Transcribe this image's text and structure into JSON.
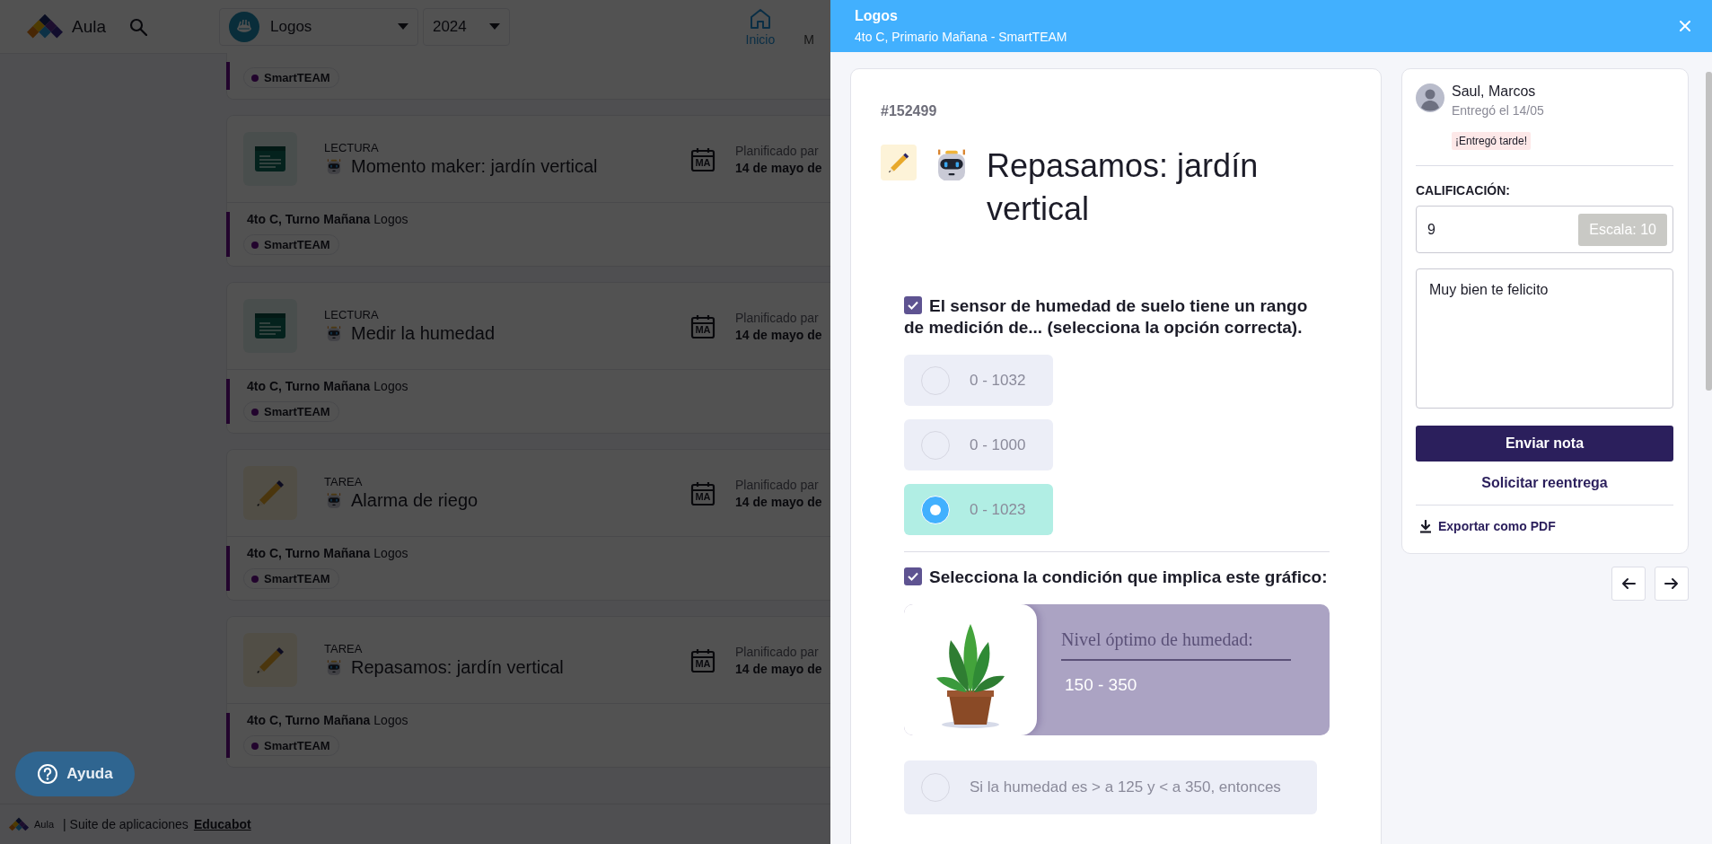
{
  "app": {
    "name": "Aula"
  },
  "header": {
    "school": {
      "value": "Logos"
    },
    "year": {
      "value": "2024"
    },
    "nav": [
      {
        "label": "Inicio",
        "selected": true
      },
      {
        "label": "M",
        "selected": false
      }
    ]
  },
  "tasks": [
    {
      "kind": "partial",
      "tag": "SmartTEAM"
    },
    {
      "kind": "reading",
      "type": "LECTURA",
      "title": "Momento maker: jardín vertical",
      "planned_label": "Planificado par",
      "weekday": "MA",
      "date": "14 de mayo de",
      "course": "4to C, Turno Mañana",
      "subject": "Logos",
      "tag": "SmartTEAM"
    },
    {
      "kind": "reading",
      "type": "LECTURA",
      "title": "Medir la humedad",
      "planned_label": "Planificado par",
      "weekday": "MA",
      "date": "14 de mayo de",
      "course": "4to C, Turno Mañana",
      "subject": "Logos",
      "tag": "SmartTEAM"
    },
    {
      "kind": "task",
      "type": "TAREA",
      "title": "Alarma de riego",
      "planned_label": "Planificado par",
      "weekday": "MA",
      "date": "14 de mayo de",
      "course": "4to C, Turno Mañana",
      "subject": "Logos",
      "tag": "SmartTEAM"
    },
    {
      "kind": "task",
      "type": "TAREA",
      "title": "Repasamos: jardín vertical",
      "planned_label": "Planificado par",
      "weekday": "MA",
      "date": "14 de mayo de",
      "course": "4to C, Turno Mañana",
      "subject": "Logos",
      "tag": "SmartTEAM"
    }
  ],
  "help_button": {
    "label": "Ayuda"
  },
  "footer": {
    "brand": "Aula",
    "text": "| Suite de aplicaciones",
    "link": "Educabot"
  },
  "drawer": {
    "title": "Logos",
    "subtitle": "4to C, Primario Mañana - SmartTEAM",
    "activity": {
      "id": "#152499",
      "title": "Repasamos: jardín vertical",
      "questions": [
        {
          "checked": true,
          "text": "El sensor de humedad de suelo tiene un rango de medición de... (selecciona la opción correcta).",
          "options": [
            {
              "label": "0 - 1032",
              "selected": false
            },
            {
              "label": "0 - 1000",
              "selected": false
            },
            {
              "label": "0 - 1023",
              "selected": true
            }
          ]
        },
        {
          "checked": true,
          "text": "Selecciona la condición que implica este gráfico:",
          "graphic": {
            "label": "Nivel óptimo de humedad:",
            "value": "150 - 350"
          },
          "options": [
            {
              "label": "Si la humedad es > a 125 y < a 350, entonces",
              "selected": false
            }
          ]
        }
      ]
    },
    "submission": {
      "student": "Saul, Marcos",
      "delivered": "Entregó el 14/05",
      "late_badge": "¡Entregó tarde!",
      "grade_label": "CALIFICACIÓN:",
      "grade": "9",
      "scale": "Escala: 10",
      "comment": "Muy bien te felicito",
      "send_button": "Enviar nota",
      "resubmit_link": "Solicitar reentrega",
      "export_link": "Exportar como PDF"
    }
  }
}
